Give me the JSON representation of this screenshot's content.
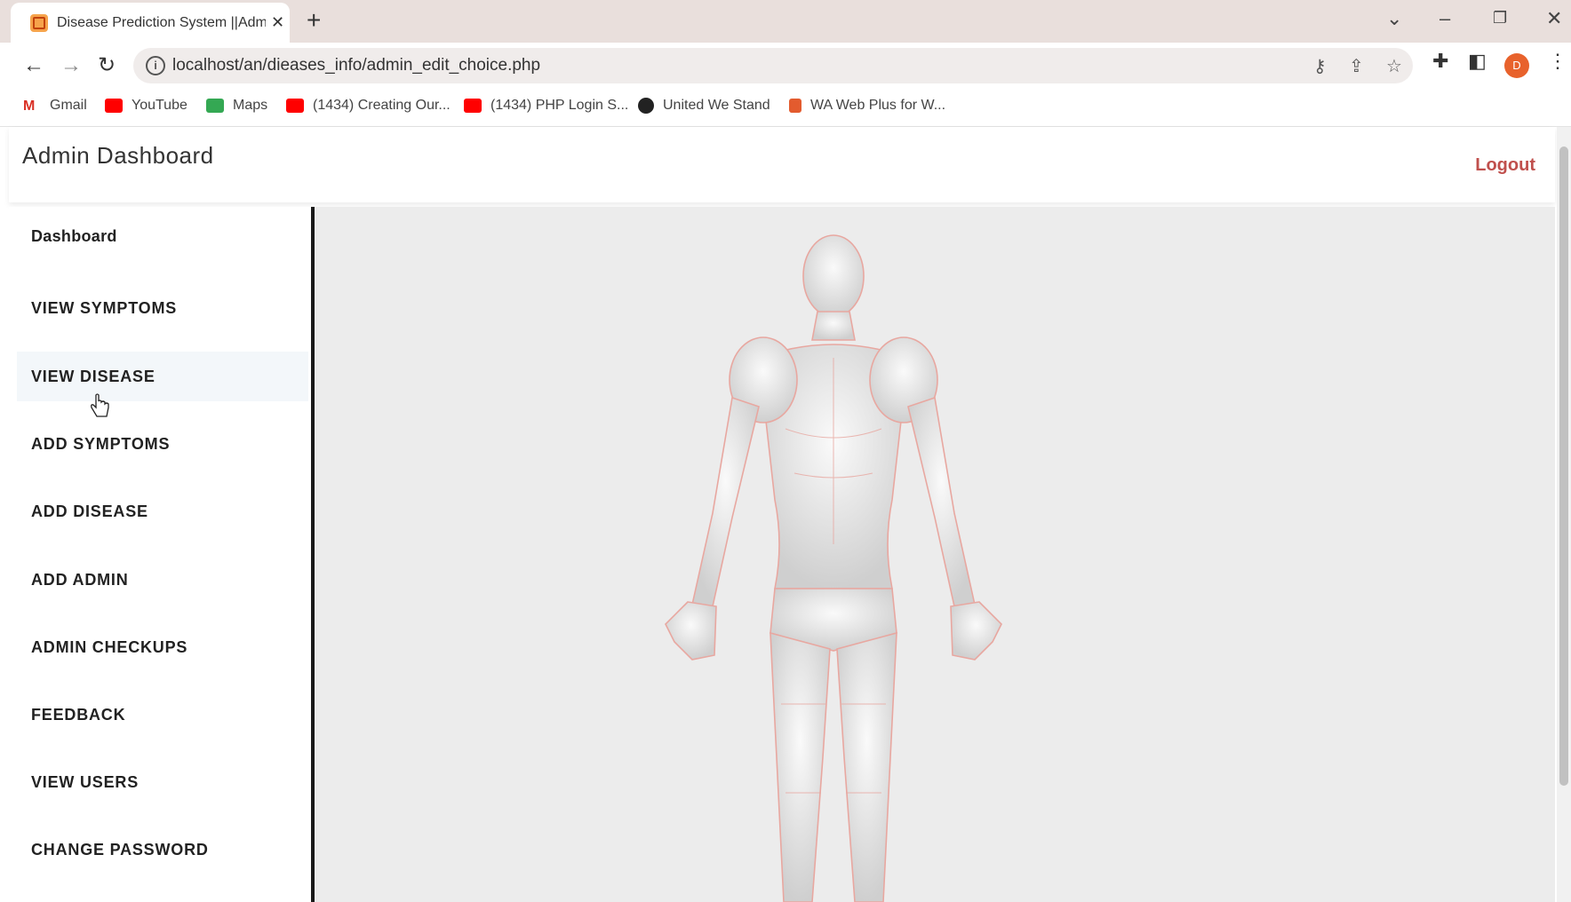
{
  "browser": {
    "tab_title": "Disease Prediction System ||Adm",
    "url": "localhost/an/dieases_info/admin_edit_choice.php",
    "profile_initial": "D",
    "bookmarks": [
      {
        "label": "Gmail",
        "icon": "gmail-icon",
        "color": "#d93025"
      },
      {
        "label": "YouTube",
        "icon": "youtube-icon",
        "color": "#ff0000"
      },
      {
        "label": "Maps",
        "icon": "maps-icon",
        "color": "#34a853"
      },
      {
        "label": "(1434) Creating Our...",
        "icon": "youtube-icon",
        "color": "#ff0000"
      },
      {
        "label": "(1434) PHP Login S...",
        "icon": "youtube-icon",
        "color": "#ff0000"
      },
      {
        "label": "United We Stand",
        "icon": "globe-icon",
        "color": "#222222"
      },
      {
        "label": "WA Web Plus for W...",
        "icon": "extension-icon",
        "color": "#e35b2e"
      }
    ]
  },
  "header": {
    "brand": "Admin Dashboard",
    "logout": "Logout"
  },
  "sidebar": {
    "items": [
      {
        "label": "Dashboard"
      },
      {
        "label": "VIEW SYMPTOMS"
      },
      {
        "label": "VIEW DISEASE"
      },
      {
        "label": "ADD SYMPTOMS"
      },
      {
        "label": "ADD DISEASE"
      },
      {
        "label": "ADD ADMIN"
      },
      {
        "label": "ADMIN CHECKUPS"
      },
      {
        "label": "FEEDBACK"
      },
      {
        "label": "VIEW USERS"
      },
      {
        "label": "CHANGE PASSWORD"
      }
    ]
  },
  "main": {
    "image": "human-body-figure",
    "accent_color": "#e8a7a0"
  }
}
